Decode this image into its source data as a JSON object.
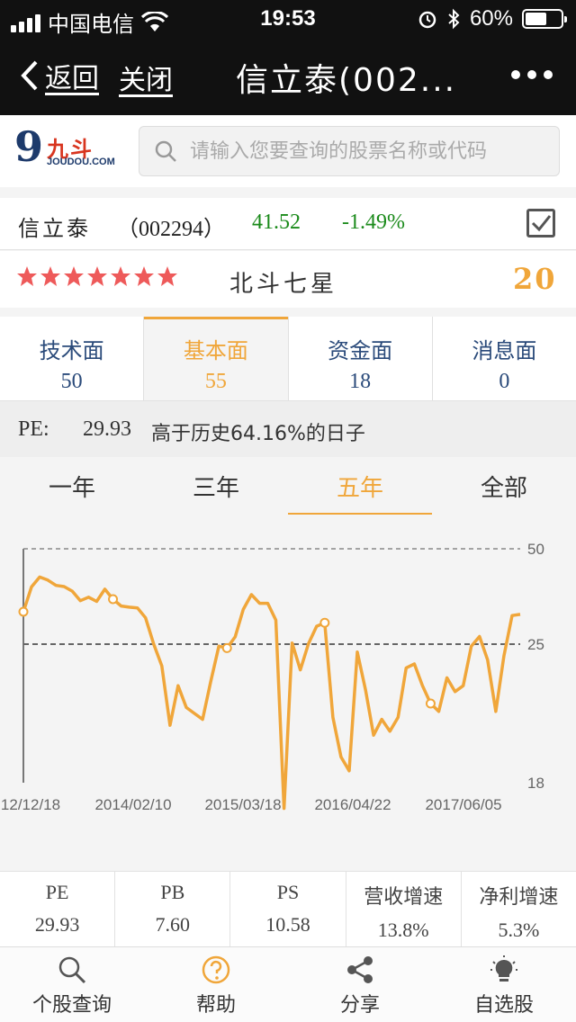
{
  "status_bar": {
    "carrier": "中国电信",
    "time": "19:53",
    "battery": "60%",
    "battery_level": 0.6
  },
  "nav": {
    "back": "返回",
    "close": "关闭",
    "title": "信立泰(002..."
  },
  "search": {
    "placeholder": "请输入您要查询的股票名称或代码",
    "logo_cn": "九斗",
    "logo_en": "JOUDOU.COM"
  },
  "stock": {
    "name": "信立泰",
    "code": "（002294）",
    "price": "41.52",
    "change": "-1.49%"
  },
  "rating": {
    "stars": 7,
    "label": "北斗七星",
    "score": "20"
  },
  "score_tabs": [
    {
      "label": "技术面",
      "value": "50"
    },
    {
      "label": "基本面",
      "value": "55"
    },
    {
      "label": "资金面",
      "value": "18"
    },
    {
      "label": "消息面",
      "value": "0"
    }
  ],
  "pe_info": {
    "label": "PE:",
    "value": "29.93",
    "description": "高于历史64.16%的日子"
  },
  "period_tabs": [
    "一年",
    "三年",
    "五年",
    "全部"
  ],
  "colors": {
    "accent": "#f0a63a",
    "down": "#1a8a1a",
    "brand_red": "#d8351f"
  },
  "chart_data": {
    "type": "line",
    "x_ticks": [
      "12/12/18",
      "2014/02/10",
      "2015/03/18",
      "2016/04/22",
      "2017/06/05"
    ],
    "y_ticks": [
      "50",
      "25",
      "18"
    ],
    "ylim": [
      18,
      50
    ],
    "series": [
      {
        "values": [
          33.5,
          40.0,
          42.6,
          41.8,
          40.4,
          40.1,
          38.9,
          36.4,
          37.3,
          36.2,
          39.4,
          36.8,
          35.0,
          34.7,
          34.5,
          31.9,
          25.0,
          23.9,
          20.9,
          22.9,
          21.8,
          21.5,
          21.2,
          23.1,
          24.9,
          24.8,
          26.9,
          34.1,
          38.0,
          35.7,
          35.7,
          31.3,
          16.7,
          25.3,
          23.7,
          25.1,
          29.7,
          30.6,
          21.3,
          19.3,
          18.6,
          24.6,
          22.7,
          20.4,
          21.2,
          20.6,
          21.3,
          23.8,
          24.0,
          22.9,
          22.0,
          21.6,
          23.3,
          22.6,
          22.9,
          24.9,
          27.0,
          24.2,
          21.6,
          24.4,
          32.5,
          32.8
        ]
      }
    ],
    "markers": [
      0,
      11,
      25,
      37,
      50
    ],
    "grid": "dashed",
    "legend": "none"
  },
  "metrics": [
    {
      "key": "PE",
      "value": "29.93"
    },
    {
      "key": "PB",
      "value": "7.60"
    },
    {
      "key": "PS",
      "value": "10.58"
    },
    {
      "key": "营收增速",
      "value": "13.8%"
    },
    {
      "key": "净利增速",
      "value": "5.3%"
    }
  ],
  "tabbar": [
    {
      "label": "个股查询",
      "icon": "search-icon"
    },
    {
      "label": "帮助",
      "icon": "help-icon"
    },
    {
      "label": "分享",
      "icon": "share-icon"
    },
    {
      "label": "自选股",
      "icon": "lightbulb-icon"
    }
  ]
}
